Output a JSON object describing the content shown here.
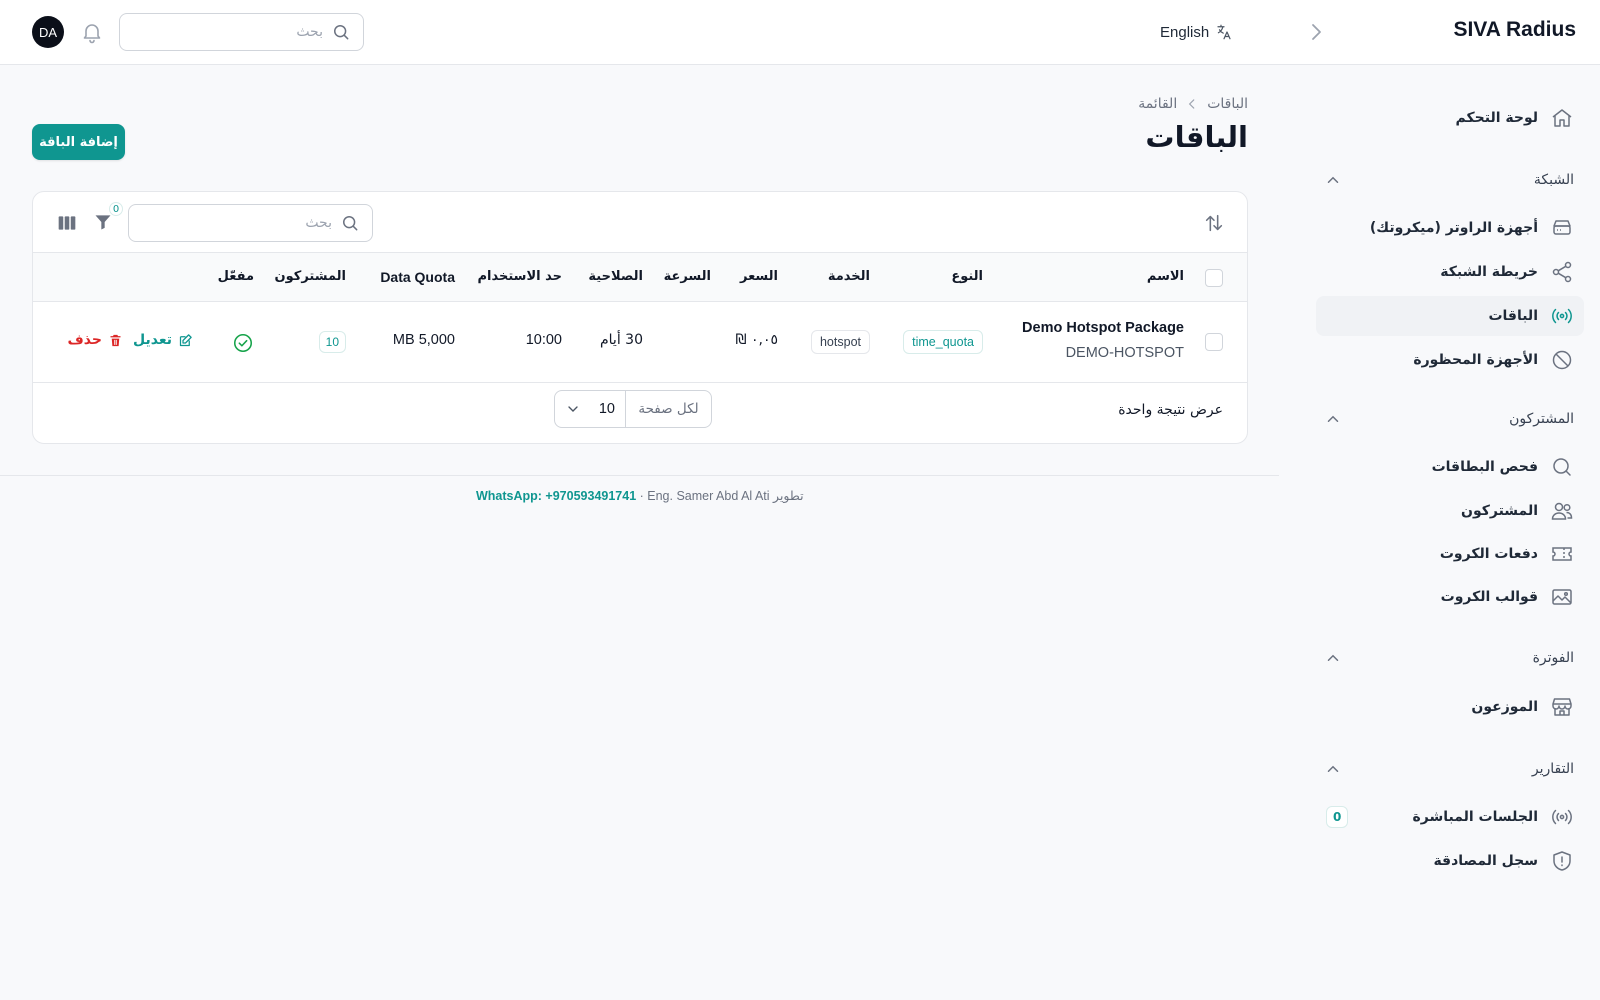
{
  "app": {
    "brand": "SIVA Radius"
  },
  "topbar": {
    "language_label": "English",
    "search_placeholder": "بحث",
    "avatar_initials": "DA"
  },
  "sidebar": {
    "dashboard": "لوحة التحكم",
    "groups": {
      "network": "الشبكة",
      "subscribers": "المشتركون",
      "billing": "الفوترة",
      "reports": "التقارير"
    },
    "network_items": [
      "أجهزة الراوتر (ميكروتك)",
      "خريطة الشبكة",
      "الباقات",
      "الأجهزة المحظورة"
    ],
    "subscriber_items": [
      "فحص البطاقات",
      "المشتركون",
      "دفعات الكروت",
      "قوالب الكروت"
    ],
    "billing_items": [
      "الموزعون"
    ],
    "reports_items": [
      "الجلسات المباشرة",
      "سجل المصادقة"
    ],
    "live_sessions_count": "0",
    "active_item": "الباقات"
  },
  "page": {
    "breadcrumb": [
      "الباقات",
      "القائمة"
    ],
    "title": "الباقات",
    "add_button": "إضافة الباقة"
  },
  "table": {
    "search_placeholder": "بحث",
    "filter_count": "0",
    "columns": [
      "الاسم",
      "النوع",
      "الخدمة",
      "السعر",
      "السرعة",
      "الصلاحية",
      "حد الاستخدام",
      "Data Quota",
      "المشتركون",
      "مفعّل"
    ],
    "rows": [
      {
        "name": "Demo Hotspot Package",
        "code": "DEMO-HOTSPOT",
        "type": "time_quota",
        "service": "hotspot",
        "price": "٠,٠٥ ₪",
        "speed": "",
        "validity": "30 أيام",
        "usage_limit": "10:00",
        "data_quota": "MB 5,000",
        "subscribers": "10",
        "active": true
      }
    ],
    "edit_label": "تعديل",
    "delete_label": "حذف",
    "results_text": "عرض نتيجة واحدة",
    "per_page_label": "لكل صفحة",
    "per_page_value": "10"
  },
  "footer": {
    "credit": "Eng. Samer Abd Al Ati تطوير",
    "whatsapp": "WhatsApp: +970593491741",
    "separator": " · "
  },
  "colors": {
    "accent": "#0f9690",
    "danger": "#dc2626",
    "success": "#16a34a"
  }
}
